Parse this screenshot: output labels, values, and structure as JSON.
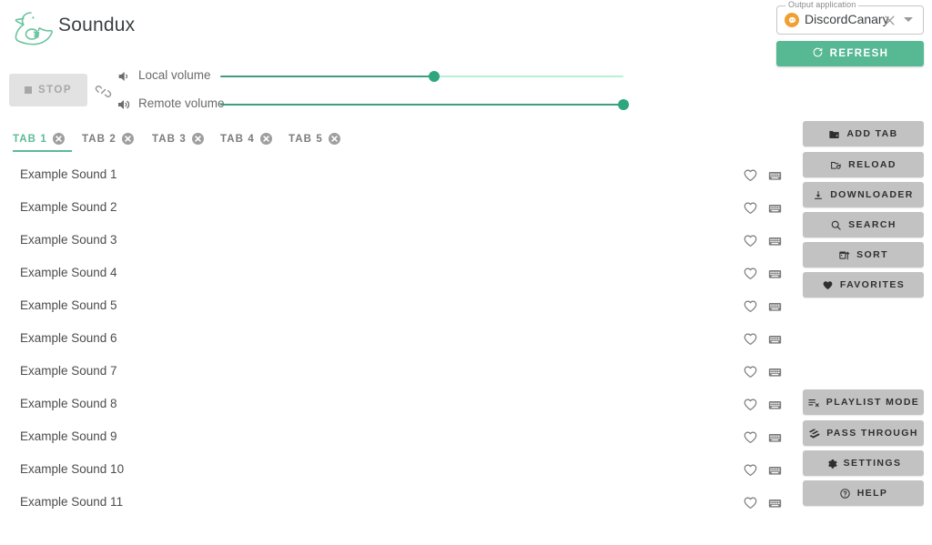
{
  "app": {
    "title": "Soundux",
    "logo_icon": "duck-logo-icon"
  },
  "output_application": {
    "legend": "Output application",
    "value": "DiscordCanary",
    "app_icon": "discord-icon",
    "clear_icon": "close-icon",
    "dropdown_icon": "chevron-down-icon",
    "icon_color": "#f0a030"
  },
  "refresh_button": {
    "label": "REFRESH",
    "icon": "refresh-icon",
    "color": "#57b894"
  },
  "transport": {
    "stop_label": "STOP",
    "stop_icon": "stop-square-icon",
    "stop_disabled": true,
    "link_icon": "link-off-icon"
  },
  "volumes": [
    {
      "label": "Local volume",
      "icon": "volume-low-icon",
      "value_percent": 53
    },
    {
      "label": "Remote volume",
      "icon": "volume-high-icon",
      "value_percent": 100
    }
  ],
  "tabs": {
    "active_index": 0,
    "close_icon": "tab-close-icon",
    "items": [
      {
        "label": "TAB 1"
      },
      {
        "label": "TAB 2"
      },
      {
        "label": "TAB 3"
      },
      {
        "label": "TAB 4"
      },
      {
        "label": "TAB 5"
      }
    ]
  },
  "sound_list": {
    "favorite_icon": "heart-outline-icon",
    "hotkey_icon": "keyboard-icon",
    "items": [
      {
        "name": "Example Sound 1"
      },
      {
        "name": "Example Sound 2"
      },
      {
        "name": "Example Sound 3"
      },
      {
        "name": "Example Sound 4"
      },
      {
        "name": "Example Sound 5"
      },
      {
        "name": "Example Sound 6"
      },
      {
        "name": "Example Sound 7"
      },
      {
        "name": "Example Sound 8"
      },
      {
        "name": "Example Sound 9"
      },
      {
        "name": "Example Sound 10"
      },
      {
        "name": "Example Sound 11"
      }
    ]
  },
  "side_buttons_top": [
    {
      "label": "ADD TAB",
      "icon": "folder-plus-icon"
    },
    {
      "label": "RELOAD",
      "icon": "folder-refresh-icon"
    },
    {
      "label": "DOWNLOADER",
      "icon": "download-icon"
    },
    {
      "label": "SEARCH",
      "icon": "search-icon"
    },
    {
      "label": "SORT",
      "icon": "sort-calendar-icon"
    },
    {
      "label": "FAVORITES",
      "icon": "heart-filled-icon"
    }
  ],
  "side_buttons_bottom": [
    {
      "label": "PLAYLIST MODE",
      "icon": "playlist-icon"
    },
    {
      "label": "PASS THROUGH",
      "icon": "layers-icon"
    },
    {
      "label": "SETTINGS",
      "icon": "gear-icon"
    },
    {
      "label": "HELP",
      "icon": "help-circle-icon"
    }
  ],
  "colors": {
    "accent_green": "#57b894",
    "accent_teal_text": "#5cbb96",
    "slider_fill": "#3f9e7c",
    "slider_track": "#b6f0d6",
    "button_gray": "#c2c2c2",
    "discord_orange": "#f0a030"
  }
}
